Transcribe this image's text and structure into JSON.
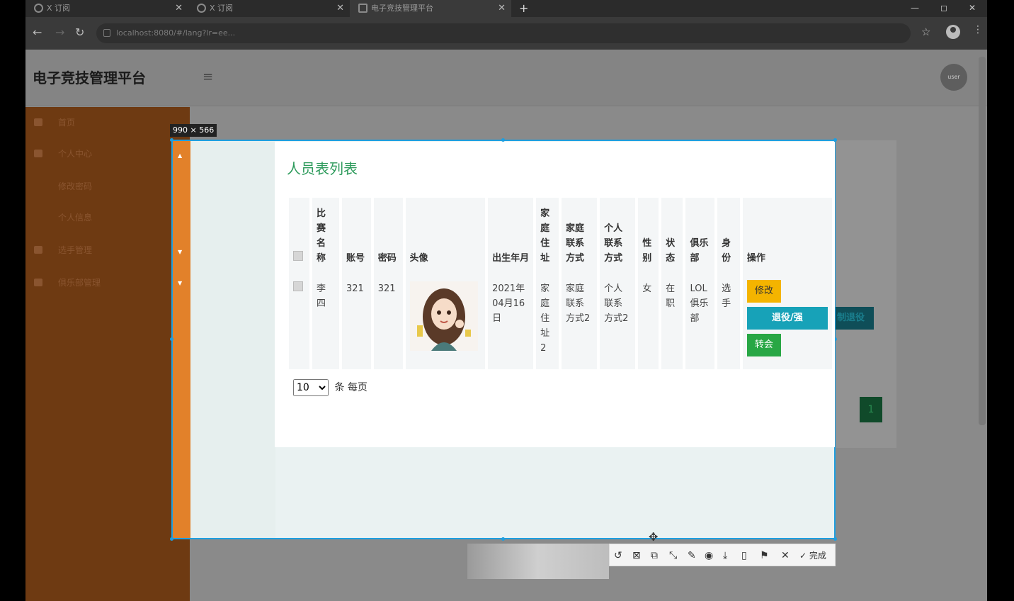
{
  "browser": {
    "tabs": [
      {
        "label": "X 订阅"
      },
      {
        "label": "X 订阅"
      },
      {
        "label": "电子竞技管理平台"
      }
    ],
    "address": "localhost:8080/#/lang?lr=ee..."
  },
  "app": {
    "title": "电子竞技管理平台",
    "avatar_text": "user"
  },
  "sidebar": {
    "items": [
      {
        "label": "首页"
      },
      {
        "label": "个人中心"
      },
      {
        "label": "修改密码"
      },
      {
        "label": "个人信息"
      },
      {
        "label": "选手管理"
      },
      {
        "label": "俱乐部管理"
      }
    ]
  },
  "overlay": {
    "dimension_label": "990 × 566",
    "toolbar_done": "完成"
  },
  "card": {
    "title": "人员表列表",
    "columns": [
      "比赛名称",
      "账号",
      "密码",
      "头像",
      "出生年月",
      "家庭住址",
      "家庭联系方式",
      "个人联系方式",
      "性别",
      "状态",
      "俱乐部",
      "身份",
      "操作"
    ],
    "rows": [
      {
        "name": "李四",
        "account": "321",
        "password": "321",
        "birth": "2021年04月16日",
        "address": "家庭住址2",
        "home_contact": "家庭联系方式2",
        "personal_contact": "个人联系方式2",
        "gender": "女",
        "status": "在职",
        "club": "LOL俱乐部",
        "role": "选手"
      }
    ],
    "actions": {
      "edit": "修改",
      "quit": "退役/强制退役",
      "quit_visible": "退役/强",
      "quit_overflow": "制退役",
      "transfer": "转会"
    },
    "pager": {
      "page_size": "10",
      "suffix": "条 每页"
    }
  },
  "pagination": {
    "current": "1"
  }
}
